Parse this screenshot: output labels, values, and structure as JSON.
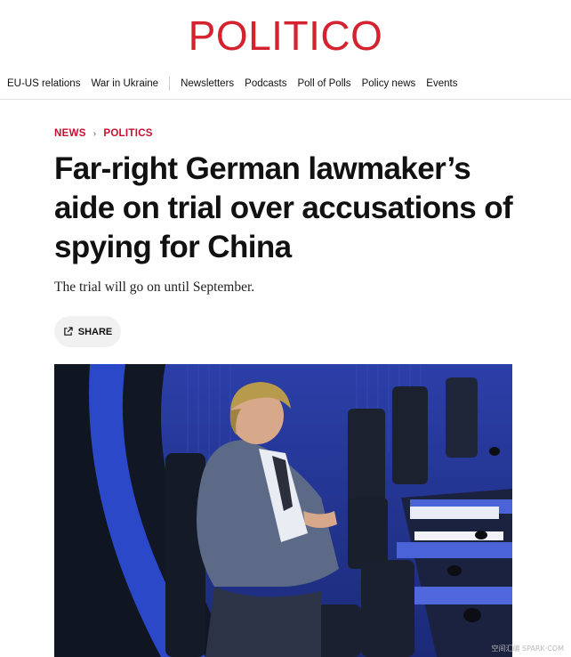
{
  "brand": {
    "logo_text": "POLITICO",
    "logo_color": "#d4232f"
  },
  "nav": {
    "items": [
      "EU-US relations",
      "War in Ukraine",
      "Newsletters",
      "Podcasts",
      "Poll of Polls",
      "Policy news",
      "Events"
    ]
  },
  "breadcrumb": {
    "section": "NEWS",
    "subsection": "POLITICS",
    "accent_color": "#c8102e"
  },
  "article": {
    "headline": "Far-right German lawmaker’s aide on trial over accusations of spying for China",
    "dek": "The trial will go on until September.",
    "share_label": "SHARE"
  },
  "photo": {
    "subject": "man seated alone in blue parliament chamber seats"
  },
  "watermark": "空间汇编 SPARK·COM"
}
